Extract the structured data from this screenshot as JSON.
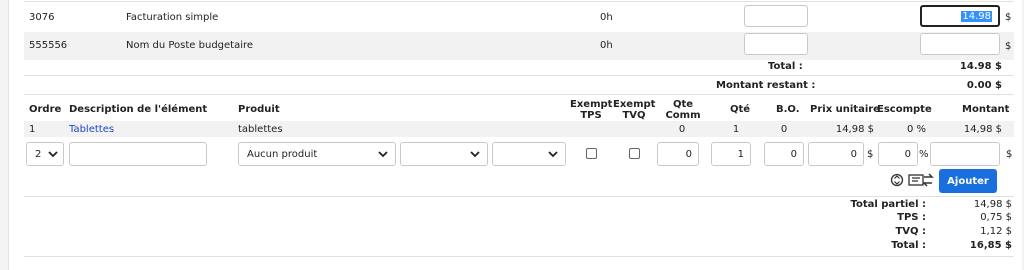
{
  "budget_lines": [
    {
      "code": "3076",
      "name": "Facturation simple",
      "hours": "0h",
      "amount": "14.98",
      "currency": "$"
    },
    {
      "code": "555556",
      "name": "Nom du Poste budgetaire",
      "hours": "0h",
      "amount": "",
      "currency": "$"
    }
  ],
  "budget_totals": {
    "total_label": "Total :",
    "total_value": "14.98 $",
    "remaining_label": "Montant restant :",
    "remaining_value": "0.00 $"
  },
  "table": {
    "headers": {
      "order": "Ordre",
      "description": "Description de l'élément",
      "product": "Produit",
      "exempt_tps": [
        "Exempt",
        "TPS"
      ],
      "exempt_tvq": [
        "Exempt",
        "TVQ"
      ],
      "qty_comm": [
        "Qte",
        "Comm"
      ],
      "qty": "Qté",
      "bo": "B.O.",
      "unit_price": "Prix unitaire",
      "discount": "Escompte",
      "amount": "Montant"
    },
    "rows": [
      {
        "order": "1",
        "description": "Tablettes",
        "product": "tablettes",
        "qty_comm": "0",
        "qty": "1",
        "bo": "0",
        "unit_price": "14,98 $",
        "discount": "0 %",
        "amount": "14,98 $"
      }
    ],
    "new_row": {
      "order": "2",
      "description": "",
      "product_select": "Aucun produit",
      "select2": "",
      "select3": "",
      "qty_comm": "0",
      "qty": "1",
      "bo": "0",
      "unit_price": "0",
      "unit_suffix": "$",
      "discount": "0",
      "discount_suffix": "%",
      "amount": "",
      "amount_suffix": "$"
    },
    "add_button": "Ajouter",
    "icons": [
      "refresh-icon",
      "tax-transfer-icon"
    ]
  },
  "summary": {
    "subtotal_label": "Total partiel :",
    "subtotal_value": "14,98 $",
    "tps_label": "TPS :",
    "tps_value": "0,75 $",
    "tvq_label": "TVQ :",
    "tvq_value": "1,12 $",
    "total_label": "Total :",
    "total_value": "16,85 $"
  },
  "colors": {
    "accent": "#1a6fde",
    "link": "#1a47c8",
    "selection": "#3390ff"
  }
}
